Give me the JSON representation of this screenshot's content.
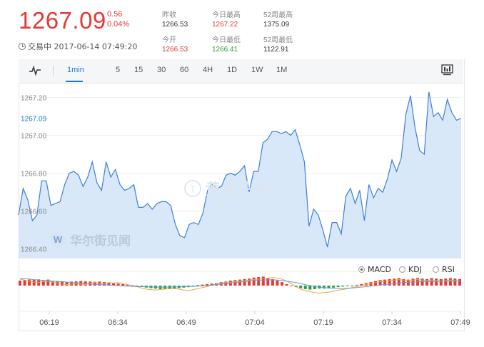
{
  "quote": {
    "price": "1267.09",
    "change": "0.56",
    "change_pct": "0.04%",
    "status": "交易中 2017-06-14 07:49:20"
  },
  "stats": [
    {
      "label": "昨收",
      "value": "1266.53",
      "color": "#333333"
    },
    {
      "label": "今日最高",
      "value": "1267.22",
      "color": "#e53935"
    },
    {
      "label": "52周最高",
      "value": "1375.09",
      "color": "#333333"
    },
    {
      "label": "今开",
      "value": "1266.53",
      "color": "#e53935"
    },
    {
      "label": "今日最低",
      "value": "1266.41",
      "color": "#2e9d3c"
    },
    {
      "label": "52周最低",
      "value": "1122.91",
      "color": "#333333"
    }
  ],
  "toolbar": {
    "chart_type_icon": "line-chart-icon",
    "timeframes": [
      "1min",
      "5",
      "15",
      "30",
      "60",
      "4H",
      "1D",
      "1W",
      "1M"
    ],
    "active_timeframe": "1min",
    "fullscreen_icon": "fullscreen-icon"
  },
  "watermarks": {
    "brand_main": "华尔街见闻",
    "brand_logo": "W",
    "brand_secondary": "黄金头条",
    "brand_secondary_logo": "T"
  },
  "indicators": {
    "options": [
      "MACD",
      "KDJ",
      "RSI"
    ],
    "selected": "MACD"
  },
  "colors": {
    "up": "#e53935",
    "down": "#2e9d3c",
    "line": "#3d7fd8",
    "area": "#cfe2f8",
    "accent": "#1976d2"
  },
  "chart_data": {
    "type": "area",
    "title": "",
    "xlabel": "",
    "ylabel": "",
    "ylim": [
      1266.35,
      1267.27
    ],
    "y_ticks": [
      1267.2,
      1267.0,
      1266.8,
      1266.6,
      1266.4
    ],
    "y_tick_labels": [
      "1267.20",
      "1267.00",
      "1266.80",
      "1266.60",
      "1266.40"
    ],
    "current_price_label": "1267.09",
    "current_price": 1267.09,
    "x_tick_labels": [
      "06:19",
      "06:34",
      "06:49",
      "07:04",
      "07:19",
      "07:34",
      "07:49"
    ],
    "series": [
      {
        "values": [
          1266.58,
          1266.72,
          1266.66,
          1266.55,
          1266.58,
          1266.76,
          1266.76,
          1266.63,
          1266.64,
          1266.65,
          1266.74,
          1266.8,
          1266.81,
          1266.79,
          1266.73,
          1266.78,
          1266.86,
          1266.75,
          1266.71,
          1266.86,
          1266.78,
          1266.82,
          1266.74,
          1266.71,
          1266.72,
          1266.74,
          1266.62,
          1266.62,
          1266.64,
          1266.61,
          1266.64,
          1266.65,
          1266.65,
          1266.63,
          1266.53,
          1266.47,
          1266.46,
          1266.53,
          1266.54,
          1266.53,
          1266.59,
          1266.71,
          1266.74,
          1266.72,
          1266.73,
          1266.79,
          1266.8,
          1266.79,
          1266.81,
          1266.84,
          1266.7,
          1266.81,
          1266.81,
          1266.96,
          1266.98,
          1267.02,
          1267.02,
          1267.01,
          1267.02,
          1267.0,
          1267.03,
          1266.95,
          1266.86,
          1266.52,
          1266.61,
          1266.58,
          1266.5,
          1266.41,
          1266.54,
          1266.54,
          1266.48,
          1266.68,
          1266.72,
          1266.64,
          1266.71,
          1266.55,
          1266.74,
          1266.67,
          1266.72,
          1266.7,
          1266.77,
          1266.87,
          1266.81,
          1266.88,
          1267.11,
          1267.21,
          1267.04,
          1266.92,
          1266.9,
          1267.23,
          1267.1,
          1267.12,
          1267.08,
          1267.19,
          1267.12,
          1267.08,
          1267.09
        ]
      }
    ],
    "macd": {
      "histogram": [
        0.02,
        0.022,
        0.024,
        0.023,
        0.025,
        0.022,
        0.024,
        0.018,
        0.017,
        0.016,
        0.015,
        0.016,
        0.017,
        0.018,
        0.017,
        0.016,
        0.015,
        0.016,
        0.014,
        0.012,
        0.01,
        0.008,
        0.006,
        0.004,
        0.002,
        0.0,
        -0.004,
        -0.008,
        -0.01,
        -0.012,
        -0.014,
        -0.013,
        -0.014,
        -0.012,
        -0.01,
        -0.008,
        -0.006,
        -0.003,
        0.002,
        0.004,
        0.006,
        0.008,
        0.01,
        0.014,
        0.016,
        0.02,
        0.022,
        0.024,
        0.026,
        0.028,
        0.032,
        0.034,
        0.036,
        0.03,
        0.026,
        0.02,
        0.014,
        0.006,
        0.0,
        -0.006,
        -0.01,
        -0.014,
        -0.016,
        -0.014,
        -0.012,
        -0.012,
        -0.01,
        -0.008,
        -0.006,
        -0.004,
        -0.002,
        -0.003,
        0.003,
        0.006,
        0.01,
        0.014,
        0.018,
        0.022,
        0.024,
        0.026,
        0.028,
        0.03,
        0.026,
        0.024,
        0.028,
        0.03,
        0.028,
        0.026,
        0.03,
        0.028,
        0.026,
        0.028,
        0.03,
        0.028,
        0.026
      ],
      "dif": [
        0.026,
        0.022,
        0.018,
        0.014,
        0.012,
        0.016,
        0.018,
        0.014,
        0.01,
        0.006,
        0.004,
        0.006,
        0.008,
        0.006,
        0.004,
        0.01,
        0.012,
        0.01,
        0.008,
        0.012,
        0.01,
        0.012,
        0.008,
        0.004,
        0.0,
        -0.004,
        -0.01,
        -0.014,
        -0.016,
        -0.018,
        -0.016,
        -0.014,
        -0.012,
        -0.012,
        -0.014,
        -0.018,
        -0.02,
        -0.016,
        -0.012,
        -0.008,
        -0.004,
        0.002,
        0.006,
        0.01,
        0.012,
        0.014,
        0.016,
        0.018,
        0.02,
        0.022,
        0.024,
        0.026,
        0.028,
        0.03,
        0.032,
        0.03,
        0.026,
        0.018,
        0.008,
        -0.004,
        -0.014,
        -0.02,
        -0.024,
        -0.028,
        -0.03,
        -0.028,
        -0.026,
        -0.022,
        -0.018,
        -0.016,
        -0.012,
        -0.008,
        -0.004,
        0.0,
        0.004,
        0.008,
        0.012,
        0.016,
        0.018,
        0.02,
        0.022,
        0.024,
        0.022,
        0.02,
        0.022,
        0.024,
        0.022,
        0.02,
        0.022,
        0.02,
        0.018,
        0.02,
        0.022,
        0.02,
        0.018
      ],
      "dea": [
        0.028,
        0.028,
        0.026,
        0.024,
        0.022,
        0.02,
        0.02,
        0.018,
        0.017,
        0.016,
        0.014,
        0.012,
        0.01,
        0.009,
        0.008,
        0.006,
        0.005,
        0.004,
        0.003,
        0.002,
        0.001,
        0.0,
        -0.001,
        -0.002,
        -0.003,
        -0.004,
        -0.004,
        -0.005,
        -0.005,
        -0.006,
        -0.006,
        -0.006,
        -0.006,
        -0.005,
        -0.005,
        -0.004,
        -0.004,
        -0.003,
        -0.002,
        -0.001,
        0.0,
        0.002,
        0.004,
        0.006,
        0.008,
        0.01,
        0.012,
        0.014,
        0.016,
        0.018,
        0.02,
        0.021,
        0.022,
        0.023,
        0.023,
        0.022,
        0.02,
        0.018,
        0.015,
        0.012,
        0.008,
        0.004,
        0.0,
        -0.003,
        -0.006,
        -0.008,
        -0.01,
        -0.011,
        -0.012,
        -0.012,
        -0.011,
        -0.01,
        -0.008,
        -0.006,
        -0.004,
        -0.002,
        0.0,
        0.002,
        0.004,
        0.006,
        0.008,
        0.01,
        0.012,
        0.013,
        0.014,
        0.015,
        0.016,
        0.016,
        0.017,
        0.017,
        0.018,
        0.018,
        0.018,
        0.018,
        0.018
      ]
    }
  }
}
